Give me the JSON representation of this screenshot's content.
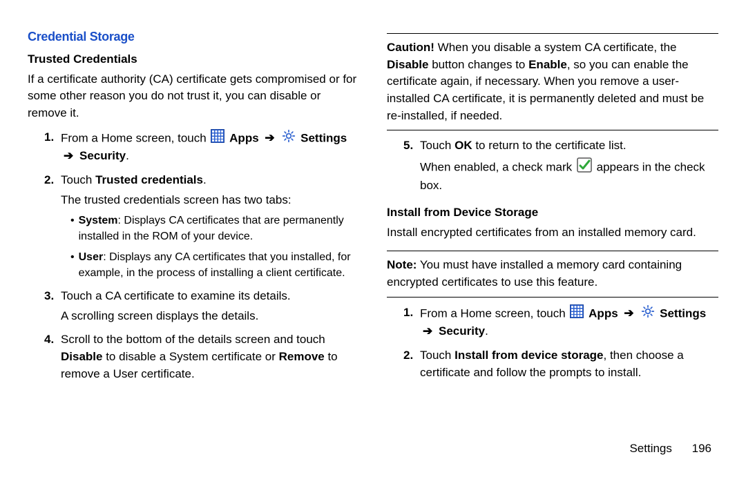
{
  "section_title": "Credential Storage",
  "sub1_title": "Trusted Credentials",
  "sub1_intro": "If a certificate authority (CA) certificate gets compromised or for some other reason you do not trust it, you can disable or remove it.",
  "step1_prefix": "From a Home screen, touch ",
  "apps_label": "Apps",
  "arrow": "➔",
  "settings_label": "Settings",
  "security_label": "Security",
  "step2_prefix": "Touch ",
  "step2_bold": "Trusted credentials",
  "step2_period": ".",
  "step2_extra": "The trusted credentials screen has two tabs:",
  "bullet1_bold": "System",
  "bullet1_text": ": Displays CA certificates that are permanently installed in the ROM of your device.",
  "bullet2_bold": "User",
  "bullet2_text": ": Displays any CA certificates that you installed, for example, in the process of installing a client certificate.",
  "step3_text": "Touch a CA certificate to examine its details.",
  "step3_extra": "A scrolling screen displays the details.",
  "step4_part1": "Scroll to the bottom of the details screen and touch ",
  "step4_bold1": "Disable",
  "step4_mid": " to disable a System certificate or ",
  "step4_bold2": "Remove",
  "step4_end": " to remove a User certificate.",
  "caution_bold": "Caution!",
  "caution_t1": " When you disable a system CA certificate, the ",
  "caution_b1": "Disable",
  "caution_t2": " button changes to ",
  "caution_b2": "Enable",
  "caution_t3": ", so you can enable the certificate again, if necessary. When you remove a user-installed CA certificate, it is permanently deleted and must be re-installed, if needed.",
  "step5_prefix": "Touch ",
  "step5_bold": "OK",
  "step5_suffix": " to return to the certificate list.",
  "step5_extra_a": "When enabled, a check mark ",
  "step5_extra_b": " appears in the check box.",
  "sub2_title": "Install from Device Storage",
  "sub2_intro": "Install encrypted certificates from an installed memory card.",
  "note_bold": "Note:",
  "note_text": " You must have installed a memory card containing encrypted certificates to use this feature.",
  "r_step2_prefix": "Touch ",
  "r_step2_bold": "Install from device storage",
  "r_step2_suffix": ", then choose a certificate and follow the prompts to install.",
  "footer_label": "Settings",
  "footer_page": "196"
}
